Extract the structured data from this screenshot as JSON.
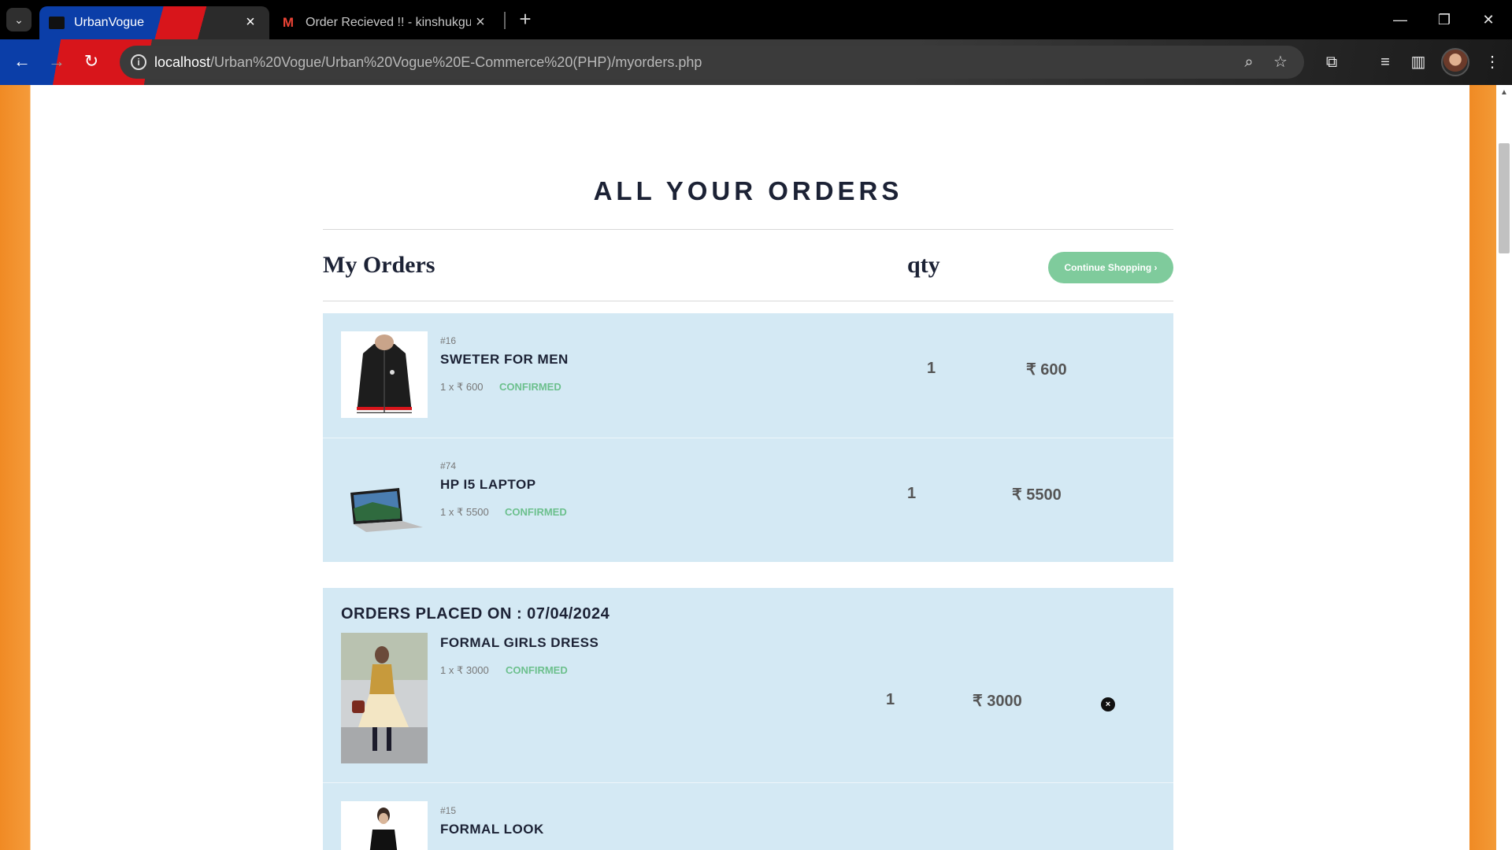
{
  "browser": {
    "tabs": [
      {
        "title": "UrbanVogue",
        "active": true
      },
      {
        "title": "Order Recieved !! - kinshukguha",
        "active": false
      }
    ],
    "new_tab_glyph": "+",
    "url_host": "localhost",
    "url_path": "/Urban%20Vogue/Urban%20Vogue%20E-Commerce%20(PHP)/myorders.php"
  },
  "page": {
    "heading": "ALL YOUR ORDERS",
    "my_orders_label": "My Orders",
    "qty_label": "qty",
    "continue_label": "Continue Shopping ›"
  },
  "group1": {
    "items": [
      {
        "id": "#16",
        "name": "SWETER FOR MEN",
        "price_line": "1 x ₹ 600",
        "status": "CONFIRMED",
        "qty": "1",
        "total": "₹ 600",
        "image": "black-sweater"
      },
      {
        "id": "#74",
        "name": "HP I5 LAPTOP",
        "price_line": "1 x ₹ 5500",
        "status": "CONFIRMED",
        "qty": "1",
        "total": "₹ 5500",
        "image": "laptop"
      }
    ]
  },
  "group2": {
    "placed_on": "ORDERS PLACED ON : 07/04/2024",
    "remove_glyph": "×",
    "items": [
      {
        "name": "FORMAL GIRLS DRESS",
        "price_line": "1 x ₹ 3000",
        "status": "CONFIRMED",
        "qty": "1",
        "total": "₹ 3000",
        "image": "girl-in-dress"
      },
      {
        "id": "#15",
        "name": "FORMAL LOOK",
        "image": "woman-formal"
      }
    ]
  },
  "colors": {
    "accent_green": "#7fcb9c",
    "status_green": "#6cc08d",
    "panel_blue": "#d4e9f4",
    "side_orange": "#f08a24",
    "heading_navy": "#1c2235"
  }
}
